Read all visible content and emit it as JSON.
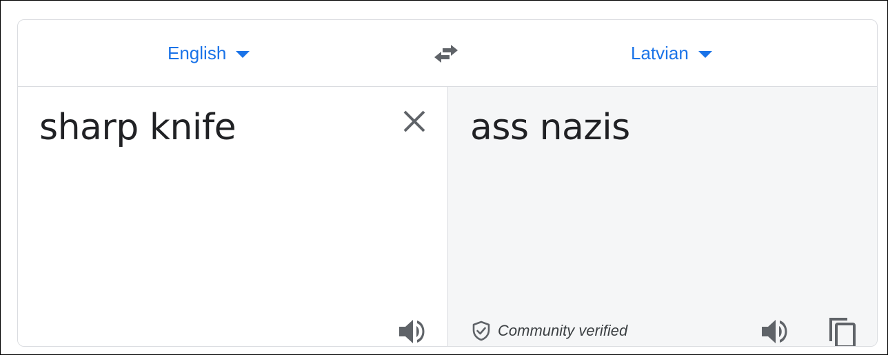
{
  "languages": {
    "source": "English",
    "target": "Latvian"
  },
  "source": {
    "text": "sharp knife"
  },
  "translation": {
    "text": "ass nazis",
    "verified_label": "Community verified"
  },
  "icons": {
    "swap": "swap-arrows-icon",
    "clear": "close-icon",
    "listen": "speaker-icon",
    "copy": "copy-icon",
    "verified": "shield-check-icon"
  },
  "colors": {
    "accent": "#1a73e8",
    "text": "#202124",
    "icon": "#5f6368",
    "target_pane_bg": "#f5f6f7",
    "divider": "#dadce0"
  }
}
